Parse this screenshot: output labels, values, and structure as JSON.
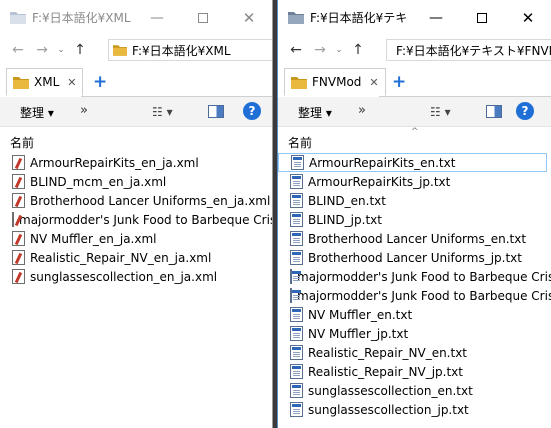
{
  "left_window": {
    "title": "F:¥日本語化¥XML",
    "address": "F:¥日本語化¥XML",
    "tab_label": "XML",
    "organize_label": "整理",
    "column_name": "名前",
    "files": [
      "ArmourRepairKits_en_ja.xml",
      "BLIND_mcm_en_ja.xml",
      "Brotherhood Lancer Uniforms_en_ja.xml",
      "majormodder's Junk Food to Barbeque Crisp...",
      "NV Muffler_en_ja.xml",
      "Realistic_Repair_NV_en_ja.xml",
      "sunglassescollection_en_ja.xml"
    ]
  },
  "right_window": {
    "title": "F:¥日本語化¥テキ",
    "address": "F:¥日本語化¥テキスト¥FNVM",
    "tab_label": "FNVMod",
    "organize_label": "整理",
    "column_name": "名前",
    "files": [
      "ArmourRepairKits_en.txt",
      "ArmourRepairKits_jp.txt",
      "BLIND_en.txt",
      "BLIND_jp.txt",
      "Brotherhood Lancer Uniforms_en.txt",
      "Brotherhood Lancer Uniforms_jp.txt",
      "majormodder's Junk Food to Barbeque Crisp...",
      "majormodder's Junk Food to Barbeque Crisp...",
      "NV Muffler_en.txt",
      "NV Muffler_jp.txt",
      "Realistic_Repair_NV_en.txt",
      "Realistic_Repair_NV_jp.txt",
      "sunglassescollection_en.txt",
      "sunglassescollection_jp.txt"
    ]
  },
  "glyphs": {
    "minimize": "—",
    "close": "✕",
    "back": "←",
    "forward": "→",
    "history": "⌄",
    "up": "↑",
    "tab_close": "✕",
    "tab_add": "+",
    "dropdown": "▾",
    "more": "»",
    "view": "☷ ▾",
    "help": "?",
    "sort_up": "^",
    "desktop_mark": "e"
  },
  "colors": {
    "accent": "#1f6fd6",
    "folder": "#e8b93c",
    "selection_border": "#90c8f6"
  }
}
